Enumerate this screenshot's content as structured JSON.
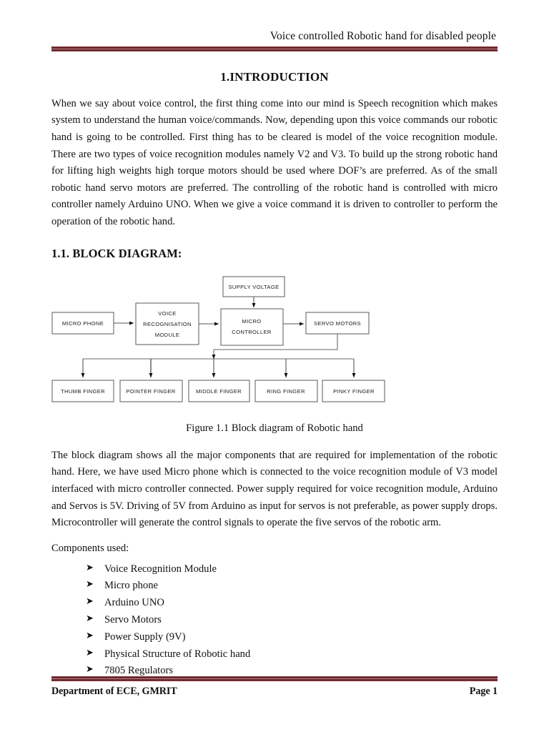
{
  "header": {
    "running_title": "Voice controlled Robotic hand for disabled people"
  },
  "headings": {
    "chapter": "1.INTRODUCTION",
    "section": "1.1. BLOCK DIAGRAM:"
  },
  "paragraphs": {
    "intro_part1": "When we say about voice control, the first thing come into our mind is Speech recognition which makes system to understand the human voice/commands. Now, depending upon this voice commands our robotic hand is going to be controlled. First thing has to be cleared is model of the voice recognition module. There are two types of voice recognition modules namely V2 and V3. To build up the strong robotic hand for lifting high weights high torque motors should be used ",
    "intro_struck_word": "where",
    "intro_part2": " DOF’s are preferred. As of the small robotic hand servo motors are preferred. The controlling of the robotic hand is controlled with micro controller namely Arduino UNO. When we give a voice command it is driven to controller to perform the operation of the robotic hand.",
    "after_figure": "The block diagram shows all the major components that are required for implementation of the robotic hand. Here, we have used Micro phone which is connected to the voice recognition module of V3 model interfaced with micro controller connected. Power supply required for voice recognition module, Arduino and Servos is 5V. Driving of 5V from Arduino as input for servos is not preferable, as power supply drops. Microcontroller will generate the control signals to operate the five servos of the robotic arm.",
    "components_lead": "Components used:"
  },
  "figure": {
    "caption": "Figure 1.1 Block diagram of Robotic hand",
    "blocks": {
      "supply_voltage": "SUPPLY VOLTAGE",
      "micro_phone": "MICRO PHONE",
      "voice_module_line1": "VOICE",
      "voice_module_line2": "RECOGNISATION",
      "voice_module_line3": "MODULE",
      "micro_controller_line1": "MICRO",
      "micro_controller_line2": "CONTROLLER",
      "servo_motors": "SERVO MOTORS",
      "finger_thumb": "THUMB FINGER",
      "finger_pointer": "POINTER FINGER",
      "finger_middle": "MIDDLE FINGER",
      "finger_ring": "RING FINGER",
      "finger_pinky": "PINKY FINGER"
    }
  },
  "components_list": [
    "Voice Recognition Module",
    "Micro phone",
    "Arduino UNO",
    "Servo Motors",
    "Power Supply (9V)",
    "Physical Structure of Robotic hand",
    "7805 Regulators"
  ],
  "list_bullet_glyph": "➤",
  "footer": {
    "left": "Department of ECE, GMRIT",
    "right": "Page 1"
  },
  "colors": {
    "rule": "#6b2428",
    "text": "#111111",
    "diagram_stroke": "#4a4a4a"
  }
}
